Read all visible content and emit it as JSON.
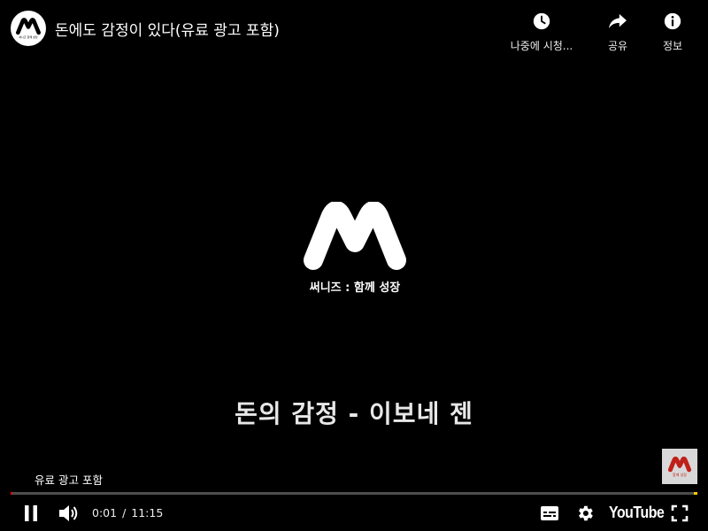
{
  "video": {
    "title": "돈에도 감정이 있다(유료 광고 포함)",
    "subtitle": "돈의 감정 - 이보네 젠",
    "paid_promotion_label": "유료 광고 포함"
  },
  "channel": {
    "avatar_caption": "써니즈 함께 성장",
    "logo_tagline": "써니즈 : 함께 성장",
    "watermark_caption": "함께 성장"
  },
  "top_actions": {
    "watch_later": "나중에 시청...",
    "share": "공유",
    "info": "정보"
  },
  "player": {
    "current_time": "0:01",
    "separator": "/",
    "duration": "11:15",
    "progress_fraction": 0.0015,
    "youtube_label": "YouTube"
  },
  "icons": {
    "watch_later": "clock-icon",
    "share": "share-arrow-icon",
    "info": "info-icon",
    "play_pause": "pause-icon",
    "volume": "volume-icon",
    "subtitles": "subtitles-icon",
    "settings": "gear-icon",
    "fullscreen": "fullscreen-icon"
  },
  "colors": {
    "background": "#000000",
    "progress_played": "#ff0000",
    "progress_ad_marker": "#ffcc00",
    "watermark_red": "#c0201a"
  }
}
